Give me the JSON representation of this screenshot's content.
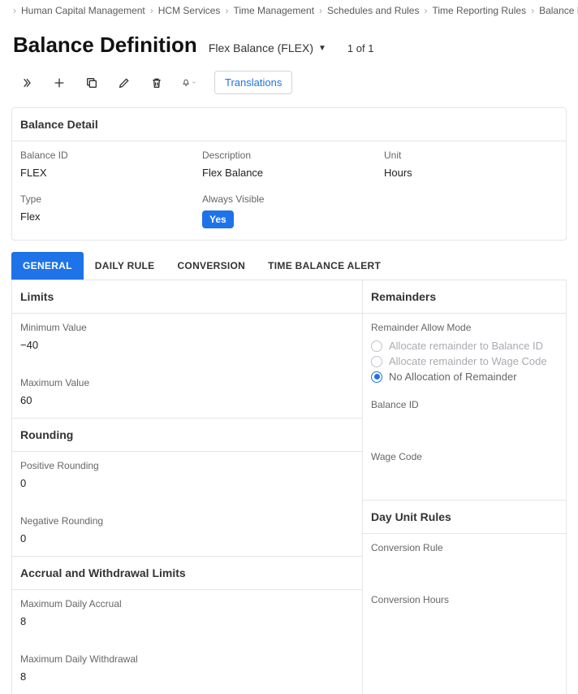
{
  "breadcrumb": {
    "items": [
      "Human Capital Management",
      "HCM Services",
      "Time Management",
      "Schedules and Rules",
      "Time Reporting Rules",
      "Balance Definition"
    ]
  },
  "header": {
    "title": "Balance Definition",
    "subtitle": "Flex Balance (FLEX)",
    "count": "1 of 1"
  },
  "toolbar": {
    "translations": "Translations"
  },
  "panel": {
    "title": "Balance Detail",
    "balance_id_label": "Balance ID",
    "balance_id_value": "FLEX",
    "type_label": "Type",
    "type_value": "Flex",
    "description_label": "Description",
    "description_value": "Flex Balance",
    "always_visible_label": "Always Visible",
    "always_visible_value": "Yes",
    "unit_label": "Unit",
    "unit_value": "Hours"
  },
  "tabs": {
    "general": "GENERAL",
    "daily_rule": "DAILY RULE",
    "conversion": "CONVERSION",
    "time_balance_alert": "TIME BALANCE ALERT"
  },
  "general": {
    "limits": {
      "title": "Limits",
      "min_label": "Minimum Value",
      "min_value": "−40",
      "max_label": "Maximum Value",
      "max_value": "60"
    },
    "rounding": {
      "title": "Rounding",
      "pos_label": "Positive Rounding",
      "pos_value": "0",
      "neg_label": "Negative Rounding",
      "neg_value": "0"
    },
    "accrual": {
      "title": "Accrual and Withdrawal Limits",
      "max_accrual_label": "Maximum Daily Accrual",
      "max_accrual_value": "8",
      "max_withdraw_label": "Maximum Daily Withdrawal",
      "max_withdraw_value": "8"
    },
    "remainders": {
      "title": "Remainders",
      "mode_label": "Remainder Allow Mode",
      "opt_balance": "Allocate remainder to Balance ID",
      "opt_wage": "Allocate remainder to Wage Code",
      "opt_none": "No Allocation of Remainder",
      "balance_id_label": "Balance ID",
      "wage_code_label": "Wage Code"
    },
    "day_unit_rules": {
      "title": "Day Unit Rules",
      "conv_rule_label": "Conversion Rule",
      "conv_hours_label": "Conversion Hours"
    }
  }
}
